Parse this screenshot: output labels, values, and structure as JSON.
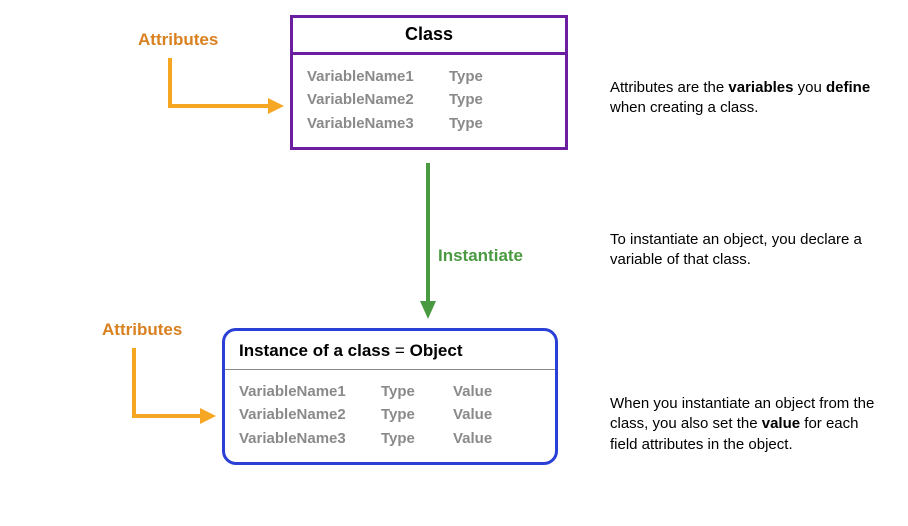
{
  "labels": {
    "attributes_top": "Attributes",
    "attributes_bottom": "Attributes",
    "instantiate": "Instantiate"
  },
  "class_box": {
    "title": "Class",
    "rows": [
      {
        "name": "VariableName1",
        "type": "Type"
      },
      {
        "name": "VariableName2",
        "type": "Type"
      },
      {
        "name": "VariableName3",
        "type": "Type"
      }
    ]
  },
  "object_box": {
    "title_prefix": "Instance of a class",
    "title_eq": "=",
    "title_obj": "Object",
    "rows": [
      {
        "name": "VariableName1",
        "type": "Type",
        "value": "Value"
      },
      {
        "name": "VariableName2",
        "type": "Type",
        "value": "Value"
      },
      {
        "name": "VariableName3",
        "type": "Type",
        "value": "Value"
      }
    ]
  },
  "desc": {
    "d1_a": "Attributes are the ",
    "d1_b": "variables",
    "d1_c": " you ",
    "d1_d": "define",
    "d1_e": " when creating a class.",
    "d2": "To instantiate an object, you declare a variable of that class.",
    "d3_a": "When you instantiate an object from the class, you also set the ",
    "d3_b": "value",
    "d3_c": " for each field attributes in the object."
  },
  "colors": {
    "attr_label": "#d9801f",
    "arrow_yellow": "#f5a623",
    "class_border": "#6b1fa0",
    "instantiate": "#4a9a42",
    "object_border": "#2a3fd6"
  }
}
